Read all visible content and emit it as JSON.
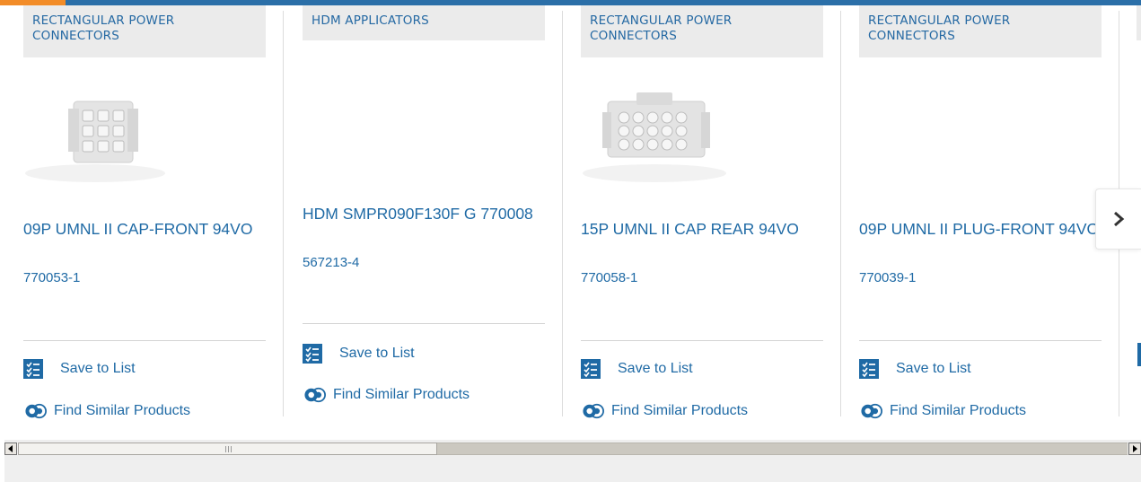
{
  "colors": {
    "brand_blue": "#1f6aa5",
    "accent_orange": "#f28c28",
    "tag_bg": "#ebebeb",
    "divider": "#dcdcdc"
  },
  "cards": [
    {
      "category": "RECTANGULAR POWER CONNECTORS",
      "title": "09P UMNL II CAP-FRONT 94VO",
      "part_number": "770053-1",
      "has_image": true,
      "image": "9-position-cap-connector"
    },
    {
      "category": "HDM APPLICATORS",
      "title": "HDM SMPR090F130F G 770008",
      "part_number": "567213-4",
      "has_image": false
    },
    {
      "category": "RECTANGULAR POWER CONNECTORS",
      "title": "15P UMNL II CAP REAR 94VO",
      "part_number": "770058-1",
      "has_image": true,
      "image": "15-position-cap-connector"
    },
    {
      "category": "RECTANGULAR POWER CONNECTORS",
      "title": "09P UMNL II PLUG-FRONT 94VO",
      "part_number": "770039-1",
      "has_image": false
    }
  ],
  "actions": {
    "save_label": "Save to List",
    "find_label": "Find Similar Products"
  },
  "icons": {
    "save": "checklist-icon",
    "find": "similar-products-icon",
    "next": "chevron-right-icon"
  }
}
